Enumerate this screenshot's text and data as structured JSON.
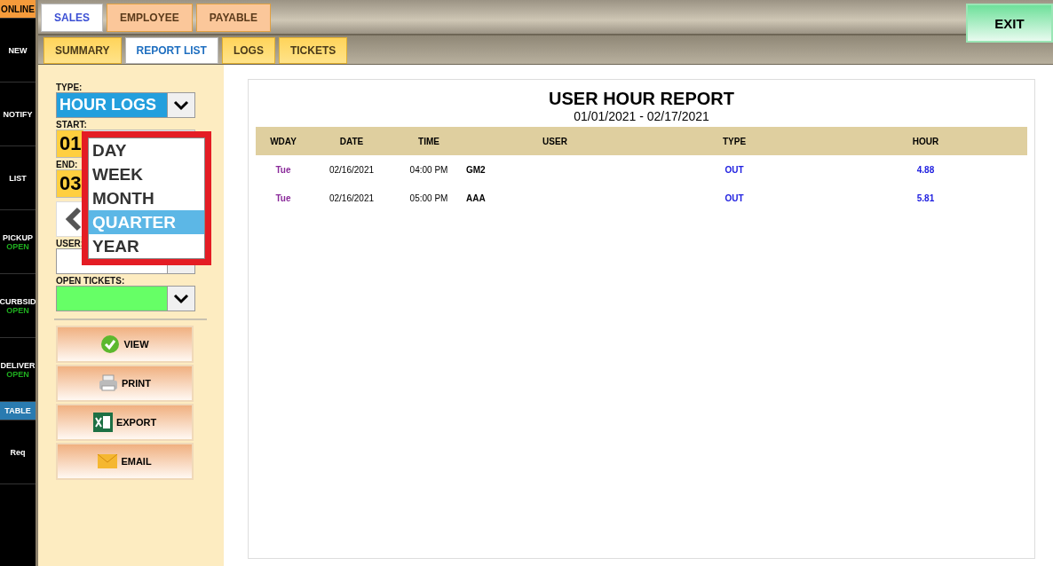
{
  "sidebar": {
    "items": [
      {
        "label": "ONLINE",
        "kind": "status",
        "selected": false
      },
      {
        "label": "NEW",
        "kind": "nav",
        "selected": false
      },
      {
        "label": "NOTIFY",
        "kind": "nav",
        "selected": false
      },
      {
        "label": "LIST",
        "kind": "nav",
        "selected": false
      },
      {
        "label": "PICKUP",
        "sub": "OPEN",
        "kind": "nav",
        "selected": false
      },
      {
        "label": "CURBSID",
        "sub": "OPEN",
        "kind": "nav",
        "selected": false
      },
      {
        "label": "DELIVER",
        "sub": "OPEN",
        "kind": "nav",
        "selected": false
      },
      {
        "label": "TABLE",
        "kind": "nav",
        "selected": true
      },
      {
        "label": "Req",
        "kind": "nav",
        "selected": false
      }
    ]
  },
  "top_tabs": [
    {
      "label": "SALES",
      "selected": true
    },
    {
      "label": "EMPLOYEE",
      "selected": false
    },
    {
      "label": "PAYABLE",
      "selected": false
    }
  ],
  "exit_button": "EXIT",
  "sub_tabs": [
    {
      "label": "SUMMARY",
      "selected": false
    },
    {
      "label": "REPORT LIST",
      "selected": true
    },
    {
      "label": "LOGS",
      "selected": false
    },
    {
      "label": "TICKETS",
      "selected": false
    }
  ],
  "filters": {
    "type_label": "TYPE:",
    "type_value": "HOUR LOGS",
    "start_label": "START:",
    "start_value": "01",
    "end_label": "END:",
    "end_value": "03",
    "user_label": "USER:",
    "open_tickets_label": "OPEN TICKETS:"
  },
  "period_dropdown": {
    "options": [
      {
        "label": "DAY",
        "selected": false
      },
      {
        "label": "WEEK",
        "selected": false
      },
      {
        "label": "MONTH",
        "selected": false
      },
      {
        "label": "QUARTER",
        "selected": true
      },
      {
        "label": "YEAR",
        "selected": false
      }
    ]
  },
  "actions": [
    {
      "label": "VIEW",
      "kind": "view"
    },
    {
      "label": "PRINT",
      "kind": "print"
    },
    {
      "label": "EXPORT",
      "kind": "export"
    },
    {
      "label": "EMAIL",
      "kind": "email"
    }
  ],
  "report": {
    "title": "USER HOUR REPORT",
    "range": "01/01/2021 - 02/17/2021",
    "columns": [
      "WDAY",
      "DATE",
      "TIME",
      "USER",
      "TYPE",
      "HOUR"
    ],
    "rows": [
      [
        "Tue",
        "02/16/2021",
        "04:00 PM",
        "GM2",
        "OUT",
        "4.88"
      ],
      [
        "Tue",
        "02/16/2021",
        "05:00 PM",
        "AAA",
        "OUT",
        "5.81"
      ]
    ]
  }
}
